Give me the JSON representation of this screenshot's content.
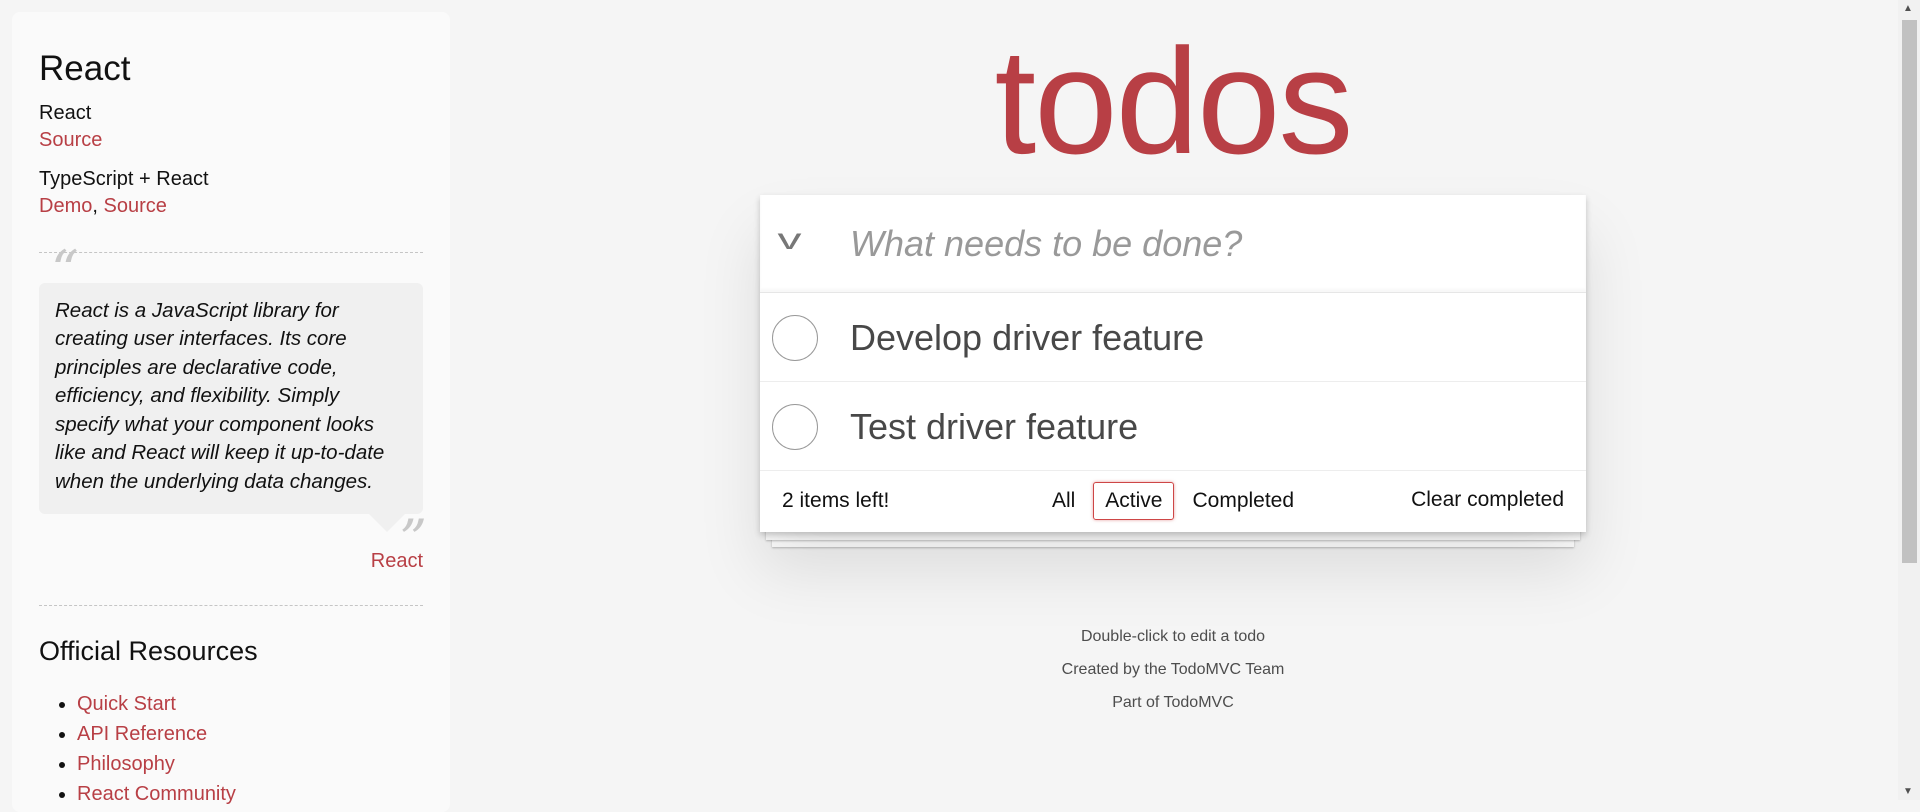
{
  "sidebar": {
    "title": "React",
    "examples": [
      {
        "name": "React",
        "links": [
          "Source"
        ]
      },
      {
        "name": "TypeScript + React",
        "links": [
          "Demo",
          "Source"
        ]
      }
    ],
    "quote": {
      "text": "React is a JavaScript library for creating user interfaces. Its core principles are declarative code, efficiency, and flexibility. Simply specify what your component looks like and React will keep it up-to-date when the underlying data changes.",
      "source": "React",
      "open_mark": "“",
      "close_mark": "”"
    },
    "resources_title": "Official Resources",
    "resources": [
      "Quick Start",
      "API Reference",
      "Philosophy",
      "React Community"
    ]
  },
  "app": {
    "title": "todos",
    "toggle_all_icon": "chevron-down-icon",
    "new_todo_placeholder": "What needs to be done?",
    "new_todo_value": "",
    "todos": [
      {
        "title": "Develop driver feature",
        "completed": false
      },
      {
        "title": "Test driver feature",
        "completed": false
      }
    ],
    "footer": {
      "count": "2 items left!",
      "filters": [
        "All",
        "Active",
        "Completed"
      ],
      "selected_filter": "Active",
      "clear": "Clear completed"
    }
  },
  "info": [
    "Double-click to edit a todo",
    "Created by the TodoMVC Team",
    "Part of TodoMVC"
  ],
  "colors": {
    "accent": "#b83f45",
    "background": "#f5f5f5"
  }
}
